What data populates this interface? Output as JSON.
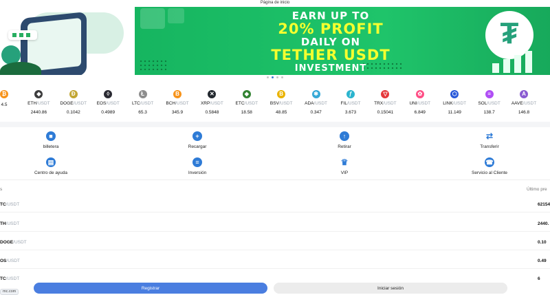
{
  "header": {
    "title": "Página de inicio"
  },
  "banner": {
    "line1": "EARN UP TO",
    "line2": "20% PROFIT",
    "line3": "DAILY ON",
    "line4": "TETHER USDT",
    "line5": "INVESTMENT",
    "slides": 4,
    "active_slide": 1
  },
  "ticker": [
    {
      "base": "",
      "quote": "",
      "price": "4.5",
      "icon": "bitcoin-icon",
      "color": "#f7931a",
      "glyph": "₿"
    },
    {
      "base": "ETH",
      "quote": "/USDT",
      "price": "2440.86",
      "icon": "ethereum-icon",
      "color": "#3c3c3d",
      "glyph": "◆"
    },
    {
      "base": "DOGE",
      "quote": "/USDT",
      "price": "0.1042",
      "icon": "dogecoin-icon",
      "color": "#c2a633",
      "glyph": "Ð"
    },
    {
      "base": "EOS",
      "quote": "/USDT",
      "price": "0.4989",
      "icon": "eos-icon",
      "color": "#2b2b33",
      "glyph": "◊"
    },
    {
      "base": "LTC",
      "quote": "/USDT",
      "price": "65.3",
      "icon": "litecoin-icon",
      "color": "#8d8d8d",
      "glyph": "Ł"
    },
    {
      "base": "BCH",
      "quote": "/USDT",
      "price": "345.9",
      "icon": "bitcoin-cash-icon",
      "color": "#f7931a",
      "glyph": "B"
    },
    {
      "base": "XRP",
      "quote": "/USDT",
      "price": "0.5848",
      "icon": "xrp-icon",
      "color": "#23292f",
      "glyph": "✕"
    },
    {
      "base": "ETC",
      "quote": "/USDT",
      "price": "18.58",
      "icon": "ethereum-classic-icon",
      "color": "#328332",
      "glyph": "◆"
    },
    {
      "base": "BSV",
      "quote": "/USDT",
      "price": "48.85",
      "icon": "bitcoin-sv-icon",
      "color": "#eab300",
      "glyph": "B"
    },
    {
      "base": "ADA",
      "quote": "/USDT",
      "price": "0.347",
      "icon": "cardano-icon",
      "color": "#35a8d6",
      "glyph": "✱"
    },
    {
      "base": "FIL",
      "quote": "/USDT",
      "price": "3.673",
      "icon": "filecoin-icon",
      "color": "#2bb4ce",
      "glyph": "ƒ"
    },
    {
      "base": "TRX",
      "quote": "/USDT",
      "price": "0.15041",
      "icon": "tron-icon",
      "color": "#e5383b",
      "glyph": "▽"
    },
    {
      "base": "UNI",
      "quote": "/USDT",
      "price": "6.849",
      "icon": "uniswap-icon",
      "color": "#ff4f86",
      "glyph": "✿"
    },
    {
      "base": "LINK",
      "quote": "/USDT",
      "price": "11.149",
      "icon": "chainlink-icon",
      "color": "#2a5ada",
      "glyph": "⬡"
    },
    {
      "base": "SOL",
      "quote": "/USDT",
      "price": "138.7",
      "icon": "solana-icon",
      "color": "#b04ef5",
      "glyph": "≡"
    },
    {
      "base": "AAVE",
      "quote": "/USDT",
      "price": "146.8",
      "icon": "aave-icon",
      "color": "#8a5bd1",
      "glyph": "A"
    }
  ],
  "menu": [
    {
      "label": "billetera",
      "icon": "wallet-icon",
      "glyph": "■"
    },
    {
      "label": "Recargar",
      "icon": "recharge-icon",
      "glyph": "+"
    },
    {
      "label": "Retirar",
      "icon": "withdraw-icon",
      "glyph": "↑"
    },
    {
      "label": "Transferir",
      "icon": "transfer-icon",
      "glyph": "⇄"
    },
    {
      "label": "Centro de ayuda",
      "icon": "help-center-icon",
      "glyph": "▤"
    },
    {
      "label": "Inversión",
      "icon": "investment-icon",
      "glyph": "≡"
    },
    {
      "label": "VIP",
      "icon": "vip-crown-icon",
      "glyph": "♛"
    },
    {
      "label": "Servicio al Cliente",
      "icon": "customer-service-icon",
      "glyph": "☎"
    }
  ],
  "market": {
    "header_left": "s",
    "header_right": "Último pre",
    "rows": [
      {
        "base": "TC",
        "quote": "/USDT",
        "price": "62154"
      },
      {
        "base": "TH",
        "quote": "/USDT",
        "price": "2440."
      },
      {
        "base": "DOGE",
        "quote": "/USDT",
        "price": "0.10"
      },
      {
        "base": "OS",
        "quote": "/USDT",
        "price": "0.49"
      },
      {
        "base": "TC",
        "quote": "/USDT",
        "price": "6"
      }
    ]
  },
  "footer": {
    "register_label": "Registrar",
    "login_label": "Iniciar sesión",
    "url_fragment": "mc.com"
  },
  "colors": {
    "banner_green": "#1fc46a",
    "banner_yellow": "#f5ff2f",
    "primary_blue": "#4a7ee0",
    "icon_blue": "#2e7bd6"
  }
}
